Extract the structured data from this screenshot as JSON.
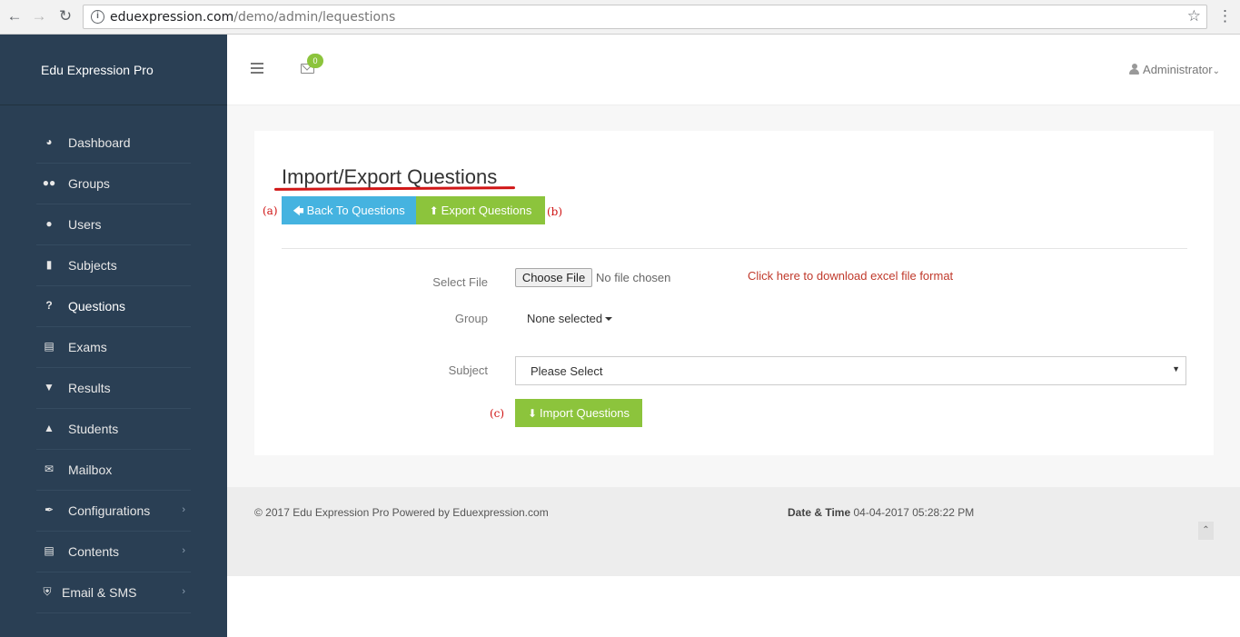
{
  "browser": {
    "url_host": "eduexpression.com",
    "url_path": "/demo/admin/lequestions"
  },
  "sidebar": {
    "brand": "Edu Expression Pro",
    "items": [
      {
        "label": "Dashboard",
        "icon": "dashboard-icon"
      },
      {
        "label": "Groups",
        "icon": "users-icon"
      },
      {
        "label": "Users",
        "icon": "user-icon"
      },
      {
        "label": "Subjects",
        "icon": "book-icon"
      },
      {
        "label": "Questions",
        "icon": "question-icon"
      },
      {
        "label": "Exams",
        "icon": "list-icon"
      },
      {
        "label": "Results",
        "icon": "trophy-icon"
      },
      {
        "label": "Students",
        "icon": "graduation-cap-icon"
      },
      {
        "label": "Mailbox",
        "icon": "envelope-icon"
      },
      {
        "label": "Configurations",
        "icon": "wrench-icon"
      },
      {
        "label": "Contents",
        "icon": "list-alt-icon"
      },
      {
        "label": "Email & SMS",
        "icon": "shield-icon"
      }
    ]
  },
  "topnav": {
    "mail_count": "0",
    "user": "Administrator"
  },
  "page": {
    "title": "Import/Export Questions",
    "back_button": "Back To Questions",
    "export_button": "Export Questions",
    "annotation_a": "(a)",
    "annotation_b": "(b)",
    "annotation_c": "(c)",
    "form": {
      "file_label": "Select File",
      "file_button": "Choose File",
      "file_status": "No file chosen",
      "download_link": "Click here to download excel file format",
      "group_label": "Group",
      "group_value": "None selected",
      "subject_label": "Subject",
      "subject_value": "Please Select",
      "import_button": "Import Questions"
    }
  },
  "footer": {
    "copyright": "© 2017 Edu Expression Pro Powered by Eduexpression.com",
    "datetime_label": "Date & Time",
    "datetime_value": "04-04-2017 05:28:22 PM"
  },
  "colors": {
    "sidebar": "#2a3f54",
    "info": "#45b3e0",
    "success": "#8cc43c",
    "annotation": "#d01616"
  }
}
